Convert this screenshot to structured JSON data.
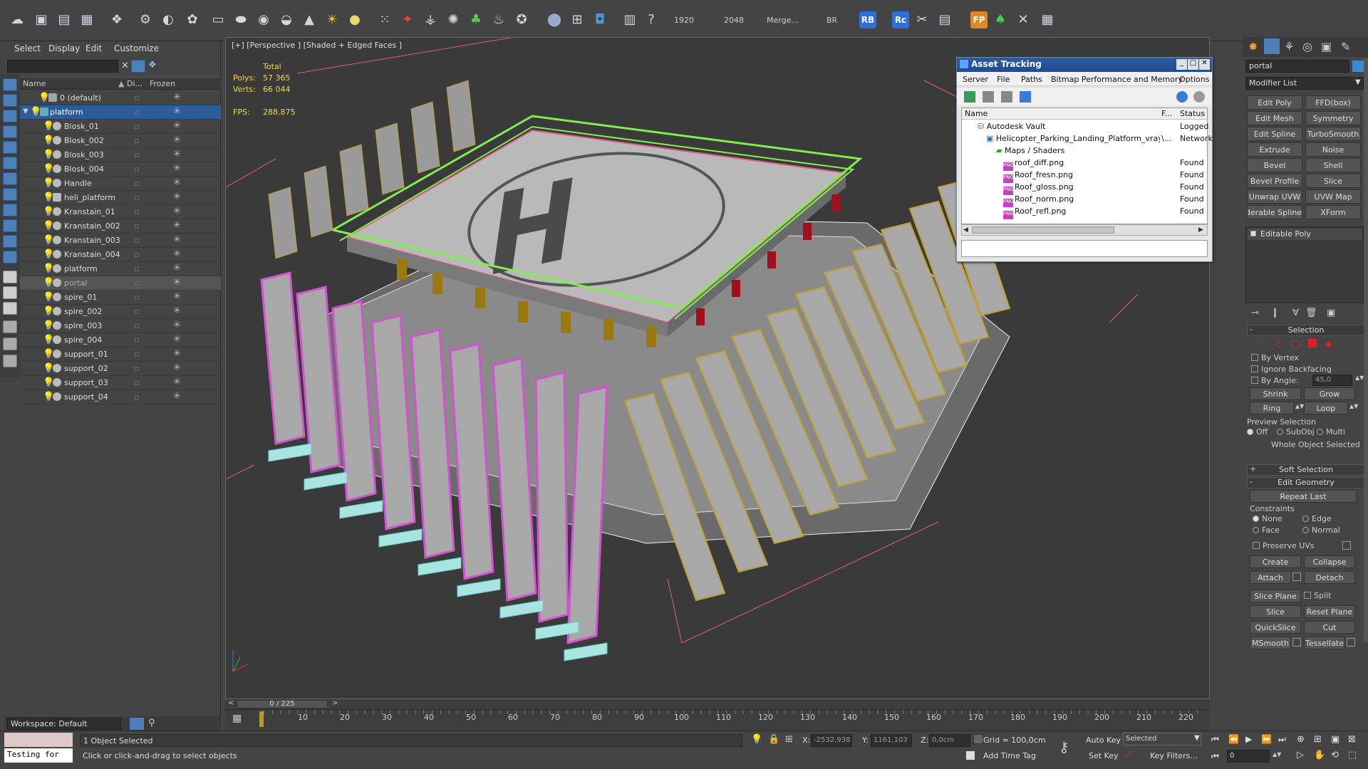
{
  "toolbar": {
    "v1920": "1920",
    "v2048": "2048",
    "merge": "Merge...",
    "br": "BR",
    "rb": "RB",
    "rc": "Rc",
    "fp": "FP"
  },
  "explorer": {
    "menu": [
      "Select",
      "Display",
      "Edit",
      "Customize"
    ],
    "columns": {
      "name": "Name",
      "display": "Di...",
      "frozen": "Frozen"
    },
    "rows": [
      "0 (default)",
      "platform",
      "Blosk_01",
      "Blosk_002",
      "Blosk_003",
      "Blosk_004",
      "Handle",
      "heli_platform",
      "Kranstain_01",
      "Kranstain_002",
      "Kranstain_003",
      "Kranstain_004",
      "platform",
      "portal",
      "spire_01",
      "spire_002",
      "spire_003",
      "spire_004",
      "support_01",
      "support_02",
      "support_03",
      "support_04"
    ],
    "workspace": "Workspace: Default"
  },
  "viewport": {
    "label": "[+] [Perspective ] [Shaded + Edged Faces ]",
    "stats": {
      "total": "Total",
      "polys_label": "Polys:",
      "polys_value": "57 365",
      "verts_label": "Verts:",
      "verts_value": "66 044",
      "fps_label": "FPS:",
      "fps_value": "288.875"
    },
    "helipad_letter": "H"
  },
  "asset": {
    "title": "Asset Tracking",
    "menu": [
      "Server",
      "File",
      "Paths",
      "Bitmap Performance and Memory",
      "Options"
    ],
    "headers": {
      "name": "Name",
      "f": "F...",
      "status": "Status"
    },
    "rows": [
      {
        "name": "Autodesk Vault",
        "f": "",
        "status": "Logged"
      },
      {
        "name": "Helicopter_Parking_Landing_Platform_vray...",
        "f": "\\...",
        "status": "Network"
      },
      {
        "name": "Maps / Shaders",
        "f": "",
        "status": ""
      },
      {
        "name": "roof_diff.png",
        "f": "",
        "status": "Found"
      },
      {
        "name": "Roof_fresn.png",
        "f": "",
        "status": "Found"
      },
      {
        "name": "Roof_gloss.png",
        "f": "",
        "status": "Found"
      },
      {
        "name": "Roof_norm.png",
        "f": "",
        "status": "Found"
      },
      {
        "name": "Roof_refl.png",
        "f": "",
        "status": "Found"
      }
    ]
  },
  "cmd": {
    "object_name": "portal",
    "modifier_list": "Modifier List",
    "modifiers": [
      [
        "Edit Poly",
        "FFD(box)"
      ],
      [
        "Edit Mesh",
        "Symmetry"
      ],
      [
        "Edit Spline",
        "TurboSmooth"
      ],
      [
        "Extrude",
        "Noise"
      ],
      [
        "Bevel",
        "Shell"
      ],
      [
        "Bevel Profile",
        "Slice"
      ],
      [
        "Unwrap UVW",
        "UVW Map"
      ],
      [
        "Renderable Spline",
        "XForm"
      ]
    ],
    "stack_item": "Editable Poly",
    "selection": {
      "title": "Selection",
      "by_vertex": "By Vertex",
      "ignore_backfacing": "Ignore Backfacing",
      "by_angle": "By Angle:",
      "angle_value": "45,0",
      "shrink": "Shrink",
      "grow": "Grow",
      "ring": "Ring",
      "loop": "Loop",
      "preview": "Preview Selection",
      "off": "Off",
      "subobj": "SubObj",
      "multi": "Multi",
      "whole": "Whole Object Selected"
    },
    "soft_selection": "Soft Selection",
    "edit_geometry": {
      "title": "Edit Geometry",
      "repeat_last": "Repeat Last",
      "constraints": "Constraints",
      "none": "None",
      "edge": "Edge",
      "face": "Face",
      "normal": "Normal",
      "preserve_uvs": "Preserve UVs",
      "create": "Create",
      "collapse": "Collapse",
      "attach": "Attach",
      "detach": "Detach",
      "slice_plane": "Slice Plane",
      "split": "Split",
      "slice": "Slice",
      "reset_plane": "Reset Plane",
      "quickslice": "QuickSlice",
      "cut": "Cut",
      "msmooth": "MSmooth",
      "tessellate": "Tessellate"
    }
  },
  "timeline": {
    "frame": "0 / 225",
    "ticks": [
      "10",
      "20",
      "30",
      "40",
      "50",
      "60",
      "70",
      "80",
      "90",
      "100",
      "110",
      "120",
      "130",
      "140",
      "150",
      "160",
      "170",
      "180",
      "190",
      "200",
      "210",
      "220"
    ]
  },
  "status": {
    "script": "Testing for",
    "selected": "1 Object Selected",
    "prompt": "Click or click-and-drag to select objects",
    "x_label": "X:",
    "x_value": "-2532,938",
    "y_label": "Y:",
    "y_value": "1161,103",
    "z_label": "Z:",
    "z_value": "0,0cm",
    "grid": "Grid = 100,0cm",
    "add_time_tag": "Add Time Tag",
    "auto_key": "Auto Key",
    "set_key": "Set Key",
    "selected_dd": "Selected",
    "key_filters": "Key Filters...",
    "frame_value": "0"
  }
}
